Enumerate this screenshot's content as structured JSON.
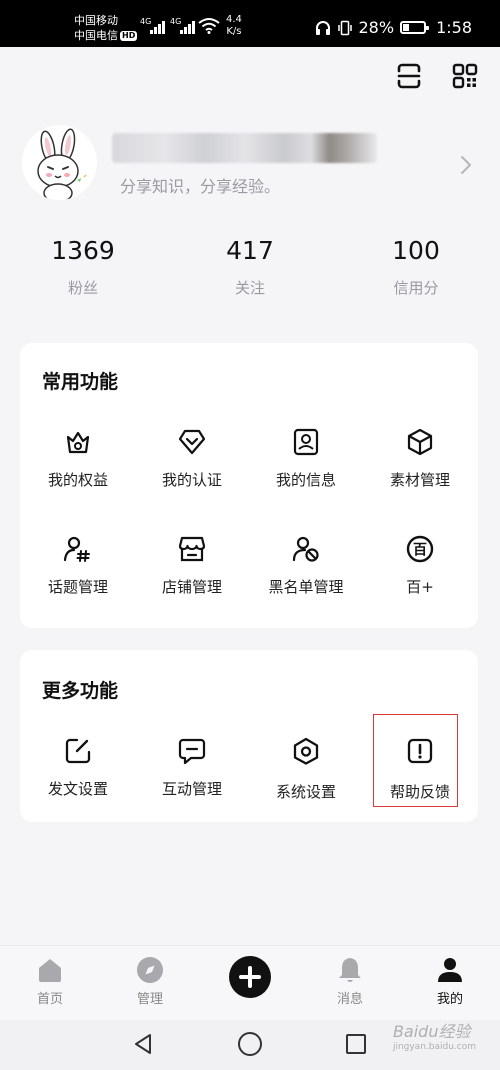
{
  "status": {
    "carrier1": "中国移动",
    "carrier2": "中国电信",
    "hd": "HD",
    "net1": "4G",
    "net2": "4G",
    "speed_value": "4.4",
    "speed_unit": "K/s",
    "battery": "28%",
    "battery_level": 0.28,
    "time": "1:58"
  },
  "profile": {
    "bio": "分享知识，分享经验。"
  },
  "stats": [
    {
      "value": "1369",
      "label": "粉丝"
    },
    {
      "value": "417",
      "label": "关注"
    },
    {
      "value": "100",
      "label": "信用分"
    }
  ],
  "common": {
    "title": "常用功能",
    "items": [
      {
        "label": "我的权益",
        "icon": "crown-icon"
      },
      {
        "label": "我的认证",
        "icon": "verified-shield-icon"
      },
      {
        "label": "我的信息",
        "icon": "profile-card-icon"
      },
      {
        "label": "素材管理",
        "icon": "cube-icon"
      },
      {
        "label": "话题管理",
        "icon": "user-hashtag-icon"
      },
      {
        "label": "店铺管理",
        "icon": "shop-icon"
      },
      {
        "label": "黑名单管理",
        "icon": "user-block-icon"
      },
      {
        "label": "百+",
        "icon": "bai-circle-icon"
      }
    ]
  },
  "more": {
    "title": "更多功能",
    "items": [
      {
        "label": "发文设置",
        "icon": "edit-icon"
      },
      {
        "label": "互动管理",
        "icon": "chat-icon"
      },
      {
        "label": "系统设置",
        "icon": "settings-hexagon-icon"
      },
      {
        "label": "帮助反馈",
        "icon": "exclamation-icon"
      }
    ]
  },
  "bai_glyph": "百",
  "nav": [
    {
      "label": "首页",
      "icon": "home-icon"
    },
    {
      "label": "管理",
      "icon": "compass-icon"
    },
    {
      "label": "消息",
      "icon": "bell-icon"
    },
    {
      "label": "我的",
      "icon": "user-icon"
    }
  ],
  "watermark": {
    "text": "Baidu经验",
    "url": "jingyan.baidu.com"
  },
  "colors": {
    "background": "#f5f5f8",
    "highlight_border": "#d83a3a",
    "active": "#111111",
    "inactive": "#888888"
  }
}
